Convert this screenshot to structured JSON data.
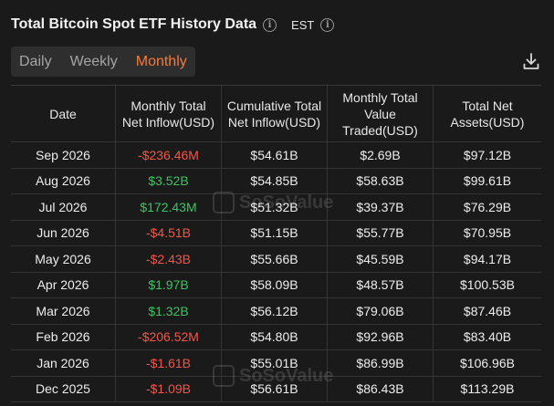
{
  "header": {
    "title": "Total Bitcoin Spot ETF History Data",
    "timezone": "EST"
  },
  "tabs": [
    {
      "label": "Daily",
      "active": false
    },
    {
      "label": "Weekly",
      "active": false
    },
    {
      "label": "Monthly",
      "active": true
    }
  ],
  "table": {
    "columns": [
      "Date",
      "Monthly Total Net Inflow(USD)",
      "Cumulative Total Net Inflow(USD)",
      "Monthly Total Value Traded(USD)",
      "Total Net Assets(USD)"
    ],
    "rows": [
      [
        "Sep 2026",
        "-$236.46M",
        "$54.61B",
        "$2.69B",
        "$97.12B"
      ],
      [
        "Aug 2026",
        "$3.52B",
        "$54.85B",
        "$58.63B",
        "$99.61B"
      ],
      [
        "Jul 2026",
        "$172.43M",
        "$51.32B",
        "$39.37B",
        "$76.29B"
      ],
      [
        "Jun 2026",
        "-$4.51B",
        "$51.15B",
        "$55.77B",
        "$70.95B"
      ],
      [
        "May 2026",
        "-$2.43B",
        "$55.66B",
        "$45.59B",
        "$94.17B"
      ],
      [
        "Apr 2026",
        "$1.97B",
        "$58.09B",
        "$48.57B",
        "$100.53B"
      ],
      [
        "Mar 2026",
        "$1.32B",
        "$56.12B",
        "$79.06B",
        "$87.46B"
      ],
      [
        "Feb 2026",
        "-$206.52M",
        "$54.80B",
        "$92.96B",
        "$83.40B"
      ],
      [
        "Jan 2026",
        "-$1.61B",
        "$55.01B",
        "$86.99B",
        "$106.96B"
      ],
      [
        "Dec 2025",
        "-$1.09B",
        "$56.61B",
        "$86.43B",
        "$113.29B"
      ]
    ]
  },
  "watermark": "SoSoValue",
  "colors": {
    "accent": "#f47a3a",
    "negative": "#f0574a",
    "positive": "#3fc262",
    "background": "#1a1a1a"
  }
}
